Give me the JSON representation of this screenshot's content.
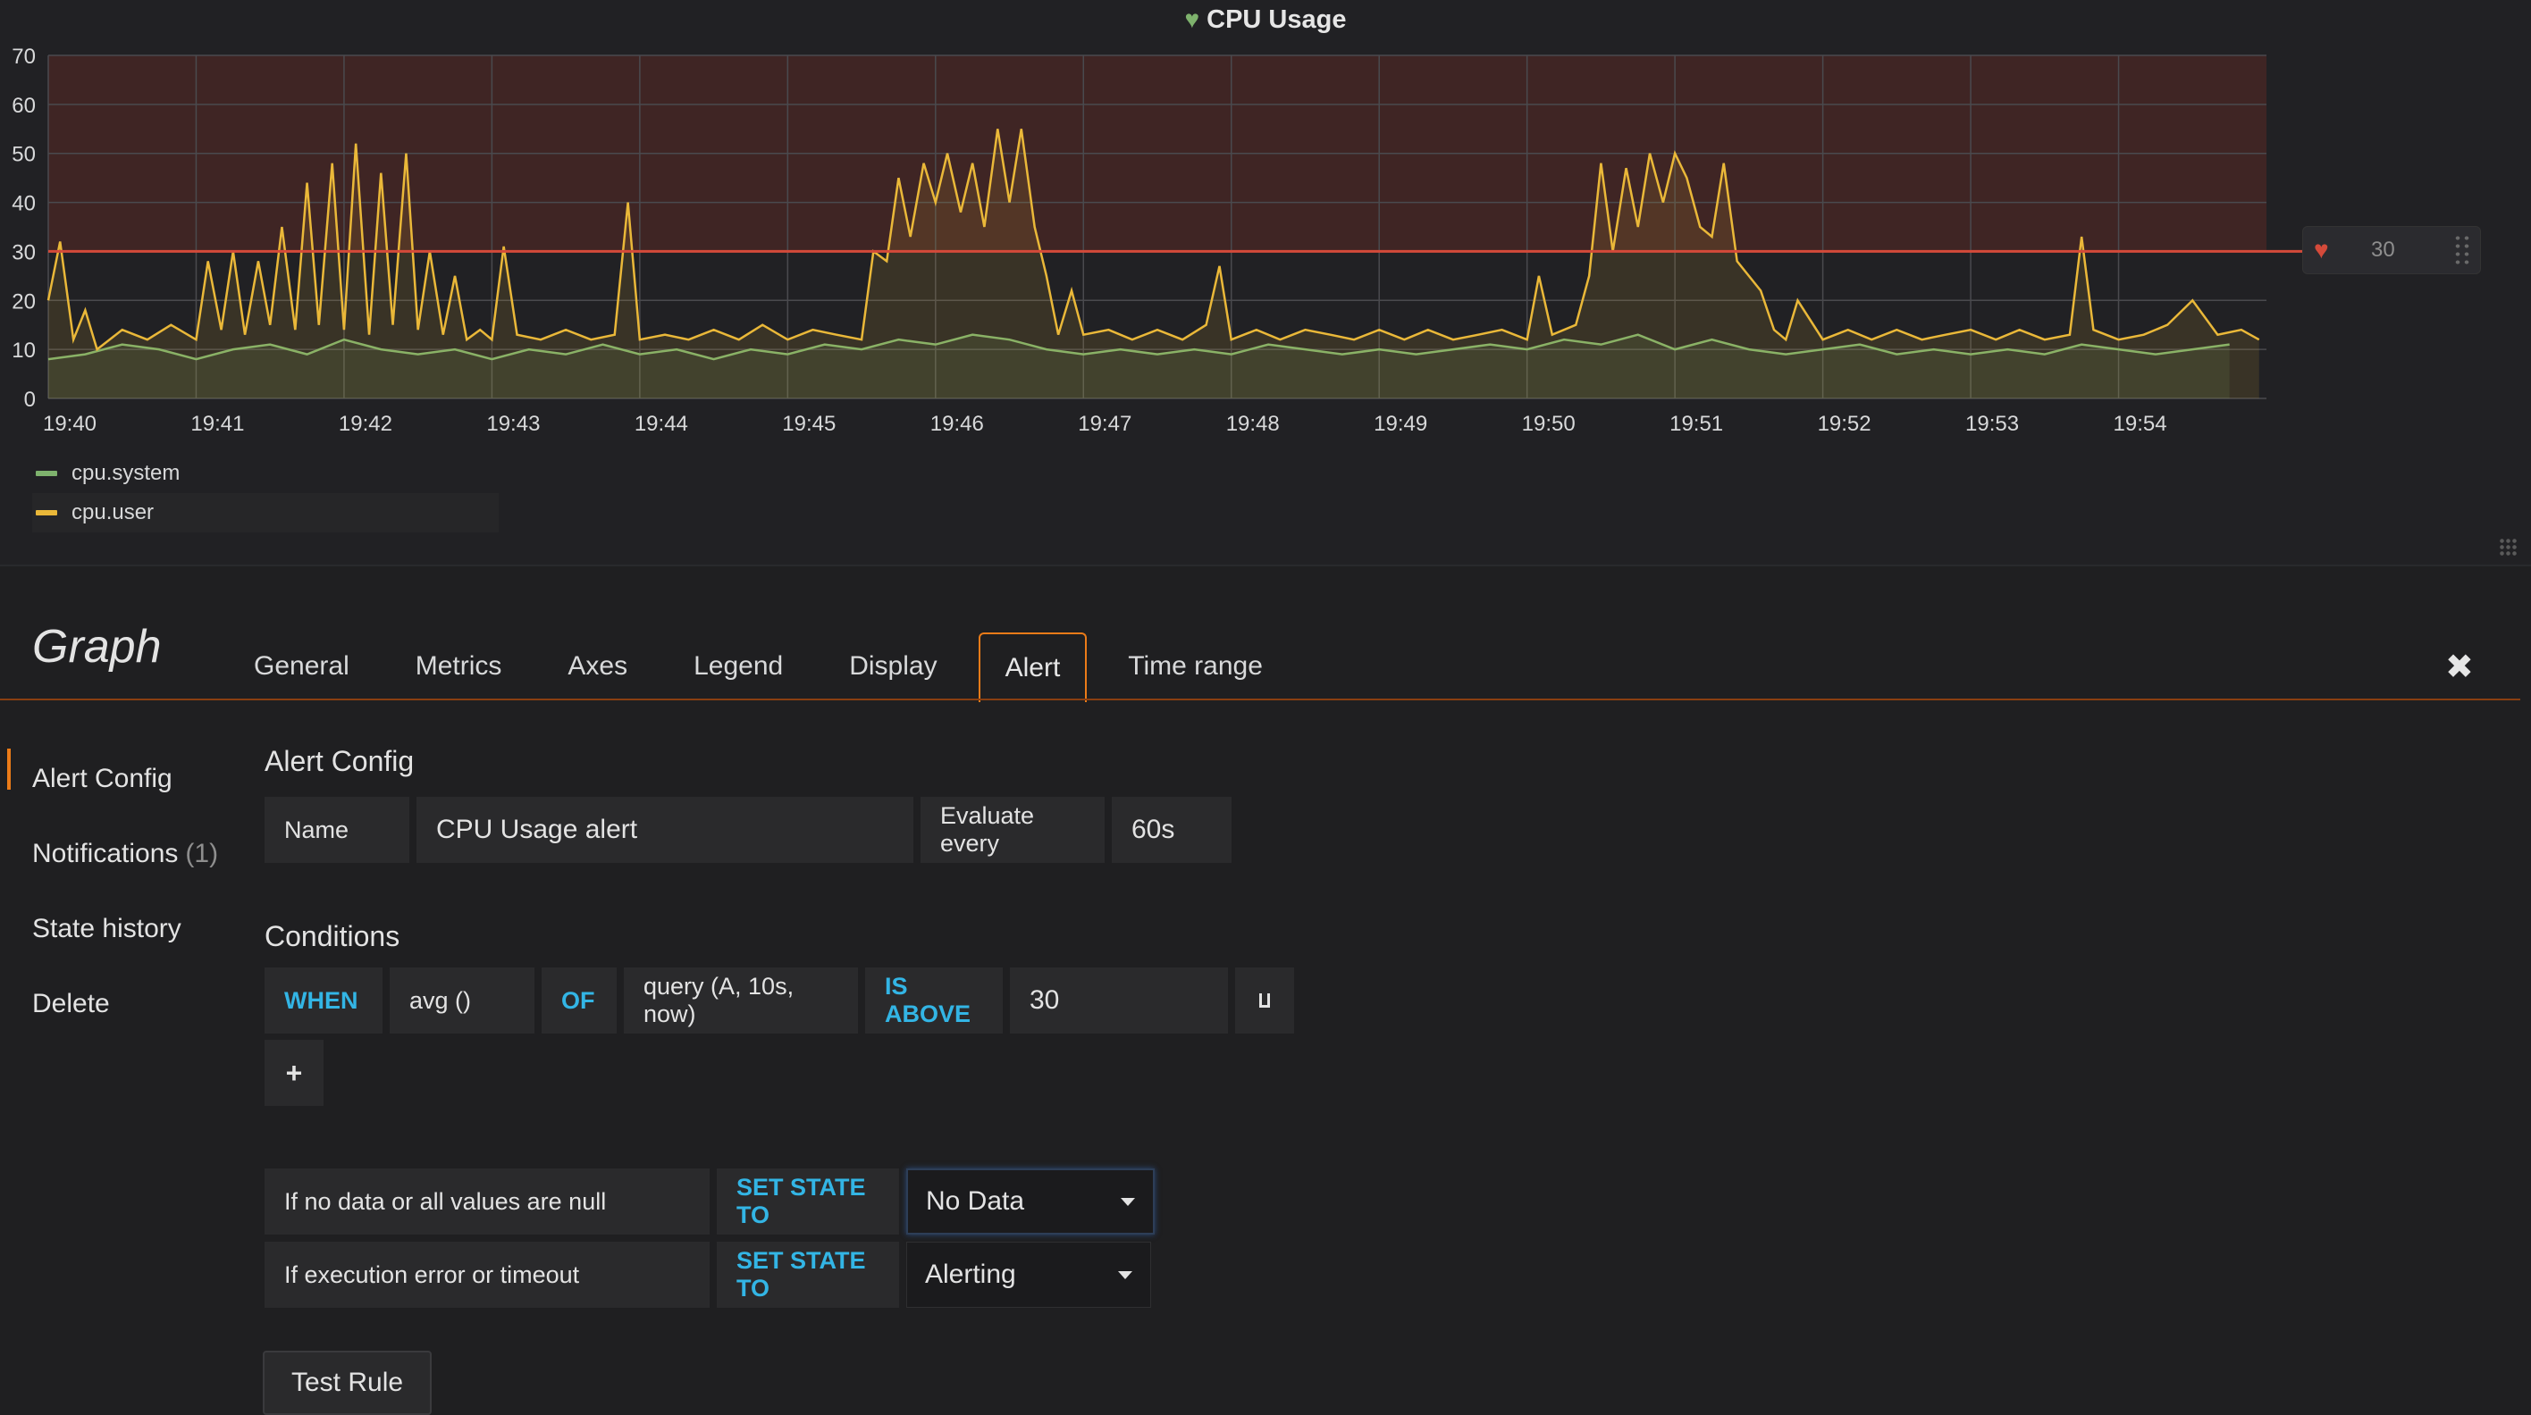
{
  "panel": {
    "title": "CPU Usage",
    "title_icon": "heart-icon",
    "threshold_handle": {
      "value": "30",
      "icon": "broken-heart-icon"
    }
  },
  "chart_data": {
    "type": "line",
    "title": "CPU Usage",
    "xlabel": "",
    "ylabel": "",
    "ylim": [
      0,
      70
    ],
    "yticks": [
      "0",
      "10",
      "20",
      "30",
      "40",
      "50",
      "60",
      "70"
    ],
    "xticks": [
      "19:40",
      "19:41",
      "19:42",
      "19:43",
      "19:44",
      "19:45",
      "19:46",
      "19:47",
      "19:48",
      "19:49",
      "19:50",
      "19:51",
      "19:52",
      "19:53",
      "19:54"
    ],
    "x_range_minutes": [
      0,
      15
    ],
    "threshold": {
      "value": 30,
      "op": "gt",
      "color": "#d44a3a",
      "fill": "#5a2a25"
    },
    "grid": true,
    "legend_position": "bottom-left",
    "series": [
      {
        "name": "cpu.system",
        "color": "#7eb26d",
        "points": [
          [
            0,
            8
          ],
          [
            0.25,
            9
          ],
          [
            0.5,
            11
          ],
          [
            0.75,
            10
          ],
          [
            1,
            8
          ],
          [
            1.25,
            10
          ],
          [
            1.5,
            11
          ],
          [
            1.75,
            9
          ],
          [
            2,
            12
          ],
          [
            2.25,
            10
          ],
          [
            2.5,
            9
          ],
          [
            2.75,
            10
          ],
          [
            3,
            8
          ],
          [
            3.25,
            10
          ],
          [
            3.5,
            9
          ],
          [
            3.75,
            11
          ],
          [
            4,
            9
          ],
          [
            4.25,
            10
          ],
          [
            4.5,
            8
          ],
          [
            4.75,
            10
          ],
          [
            5,
            9
          ],
          [
            5.25,
            11
          ],
          [
            5.5,
            10
          ],
          [
            5.75,
            12
          ],
          [
            6,
            11
          ],
          [
            6.25,
            13
          ],
          [
            6.5,
            12
          ],
          [
            6.75,
            10
          ],
          [
            7,
            9
          ],
          [
            7.25,
            10
          ],
          [
            7.5,
            9
          ],
          [
            7.75,
            10
          ],
          [
            8,
            9
          ],
          [
            8.25,
            11
          ],
          [
            8.5,
            10
          ],
          [
            8.75,
            9
          ],
          [
            9,
            10
          ],
          [
            9.25,
            9
          ],
          [
            9.5,
            10
          ],
          [
            9.75,
            11
          ],
          [
            10,
            10
          ],
          [
            10.25,
            12
          ],
          [
            10.5,
            11
          ],
          [
            10.75,
            13
          ],
          [
            11,
            10
          ],
          [
            11.25,
            12
          ],
          [
            11.5,
            10
          ],
          [
            11.75,
            9
          ],
          [
            12,
            10
          ],
          [
            12.25,
            11
          ],
          [
            12.5,
            9
          ],
          [
            12.75,
            10
          ],
          [
            13,
            9
          ],
          [
            13.25,
            10
          ],
          [
            13.5,
            9
          ],
          [
            13.75,
            11
          ],
          [
            14,
            10
          ],
          [
            14.25,
            9
          ],
          [
            14.5,
            10
          ],
          [
            14.75,
            11
          ]
        ]
      },
      {
        "name": "cpu.user",
        "color": "#eab839",
        "points": [
          [
            0,
            20
          ],
          [
            0.08,
            32
          ],
          [
            0.17,
            12
          ],
          [
            0.25,
            18
          ],
          [
            0.33,
            10
          ],
          [
            0.5,
            14
          ],
          [
            0.67,
            12
          ],
          [
            0.83,
            15
          ],
          [
            1,
            12
          ],
          [
            1.08,
            28
          ],
          [
            1.17,
            14
          ],
          [
            1.25,
            30
          ],
          [
            1.33,
            13
          ],
          [
            1.42,
            28
          ],
          [
            1.5,
            15
          ],
          [
            1.58,
            35
          ],
          [
            1.67,
            14
          ],
          [
            1.75,
            44
          ],
          [
            1.83,
            15
          ],
          [
            1.92,
            48
          ],
          [
            2,
            14
          ],
          [
            2.08,
            52
          ],
          [
            2.17,
            13
          ],
          [
            2.25,
            46
          ],
          [
            2.33,
            15
          ],
          [
            2.42,
            50
          ],
          [
            2.5,
            14
          ],
          [
            2.58,
            30
          ],
          [
            2.67,
            13
          ],
          [
            2.75,
            25
          ],
          [
            2.83,
            12
          ],
          [
            2.92,
            14
          ],
          [
            3,
            12
          ],
          [
            3.08,
            31
          ],
          [
            3.17,
            13
          ],
          [
            3.33,
            12
          ],
          [
            3.5,
            14
          ],
          [
            3.67,
            12
          ],
          [
            3.83,
            13
          ],
          [
            3.92,
            40
          ],
          [
            4,
            12
          ],
          [
            4.17,
            13
          ],
          [
            4.33,
            12
          ],
          [
            4.5,
            14
          ],
          [
            4.67,
            12
          ],
          [
            4.83,
            15
          ],
          [
            5,
            12
          ],
          [
            5.17,
            14
          ],
          [
            5.33,
            13
          ],
          [
            5.5,
            12
          ],
          [
            5.58,
            30
          ],
          [
            5.67,
            28
          ],
          [
            5.75,
            45
          ],
          [
            5.83,
            33
          ],
          [
            5.92,
            48
          ],
          [
            6,
            40
          ],
          [
            6.08,
            50
          ],
          [
            6.17,
            38
          ],
          [
            6.25,
            48
          ],
          [
            6.33,
            35
          ],
          [
            6.42,
            55
          ],
          [
            6.5,
            40
          ],
          [
            6.58,
            55
          ],
          [
            6.67,
            35
          ],
          [
            6.75,
            25
          ],
          [
            6.83,
            13
          ],
          [
            6.92,
            22
          ],
          [
            7,
            13
          ],
          [
            7.17,
            14
          ],
          [
            7.33,
            12
          ],
          [
            7.5,
            14
          ],
          [
            7.67,
            12
          ],
          [
            7.83,
            15
          ],
          [
            7.92,
            27
          ],
          [
            8,
            12
          ],
          [
            8.17,
            14
          ],
          [
            8.33,
            12
          ],
          [
            8.5,
            14
          ],
          [
            8.67,
            13
          ],
          [
            8.83,
            12
          ],
          [
            9,
            14
          ],
          [
            9.17,
            12
          ],
          [
            9.33,
            14
          ],
          [
            9.5,
            12
          ],
          [
            9.67,
            13
          ],
          [
            9.83,
            14
          ],
          [
            10,
            12
          ],
          [
            10.08,
            25
          ],
          [
            10.17,
            13
          ],
          [
            10.33,
            15
          ],
          [
            10.42,
            25
          ],
          [
            10.5,
            48
          ],
          [
            10.58,
            30
          ],
          [
            10.67,
            47
          ],
          [
            10.75,
            35
          ],
          [
            10.83,
            50
          ],
          [
            10.92,
            40
          ],
          [
            11,
            50
          ],
          [
            11.08,
            45
          ],
          [
            11.17,
            35
          ],
          [
            11.25,
            33
          ],
          [
            11.33,
            48
          ],
          [
            11.42,
            28
          ],
          [
            11.5,
            25
          ],
          [
            11.58,
            22
          ],
          [
            11.67,
            14
          ],
          [
            11.75,
            12
          ],
          [
            11.83,
            20
          ],
          [
            12,
            12
          ],
          [
            12.17,
            14
          ],
          [
            12.33,
            12
          ],
          [
            12.5,
            14
          ],
          [
            12.67,
            12
          ],
          [
            12.83,
            13
          ],
          [
            13,
            14
          ],
          [
            13.17,
            12
          ],
          [
            13.33,
            14
          ],
          [
            13.5,
            12
          ],
          [
            13.67,
            13
          ],
          [
            13.75,
            33
          ],
          [
            13.83,
            14
          ],
          [
            14,
            12
          ],
          [
            14.17,
            13
          ],
          [
            14.33,
            15
          ],
          [
            14.5,
            20
          ],
          [
            14.67,
            13
          ],
          [
            14.83,
            14
          ],
          [
            14.95,
            12
          ]
        ]
      }
    ]
  },
  "legend": [
    {
      "label": "cpu.system",
      "color": "#7eb26d"
    },
    {
      "label": "cpu.user",
      "color": "#eab839"
    }
  ],
  "editor": {
    "title": "Graph",
    "tabs": [
      "General",
      "Metrics",
      "Axes",
      "Legend",
      "Display",
      "Alert",
      "Time range"
    ],
    "active_tab": "Alert",
    "close_icon": "close-icon"
  },
  "side_nav": {
    "alert_config": "Alert Config",
    "notifications": "Notifications",
    "notifications_count": "(1)",
    "state_history": "State history",
    "delete": "Delete"
  },
  "alert_config": {
    "heading": "Alert Config",
    "name_label": "Name",
    "name_value": "CPU Usage alert",
    "evaluate_label": "Evaluate every",
    "evaluate_value": "60s"
  },
  "conditions": {
    "heading": "Conditions",
    "when": "WHEN",
    "reducer": "avg ()",
    "of": "OF",
    "query": "query (A, 10s, now)",
    "evaluator": "IS ABOVE",
    "threshold": "30",
    "add_label": "+"
  },
  "no_data": {
    "label": "If no data or all values are null",
    "keyword": "SET STATE TO",
    "value": "No Data"
  },
  "exec_error": {
    "label": "If execution error or timeout",
    "keyword": "SET STATE TO",
    "value": "Alerting"
  },
  "test_rule": "Test Rule"
}
